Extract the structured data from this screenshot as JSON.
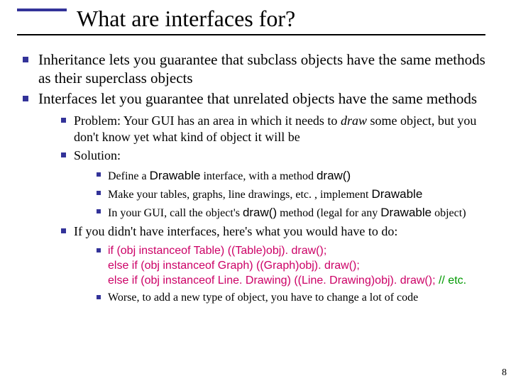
{
  "title": "What are interfaces for?",
  "b1": {
    "i0": "Inheritance lets you guarantee that subclass objects have the same methods as their superclass objects",
    "i1": "Interfaces let you guarantee that unrelated objects have the same methods"
  },
  "b2": {
    "problem_pre": "Problem: Your GUI has an area in which it needs to ",
    "problem_draw": "draw",
    "problem_post": " some object, but you don't know yet what kind of object it will be",
    "solution": "Solution:",
    "b3a": {
      "i0_pre": "Define a ",
      "i0_drawable": "Drawable",
      "i0_mid": " interface, with a method ",
      "i0_draw": "draw()",
      "i1_pre": "Make your tables, graphs, line drawings, etc. , implement ",
      "i1_drawable": "Drawable",
      "i2_pre": "In your GUI, call the object's ",
      "i2_draw": "draw()",
      "i2_mid": " method (legal for any ",
      "i2_drawable": "Drawable",
      "i2_post": " object)"
    },
    "ifnot": "If you didn't have interfaces, here's what you would have to do:",
    "b3b": {
      "l1": "if (obj instanceof Table) ((Table)obj). draw();",
      "l2": "else if (obj instanceof Graph) ((Graph)obj). draw();",
      "l3": "else if (obj instanceof Line. Drawing) ((Line. Drawing)obj). draw(); ",
      "l3c": "// etc.",
      "worse": "Worse, to add a new type of object, you have to change a lot of code"
    }
  },
  "page": "8"
}
